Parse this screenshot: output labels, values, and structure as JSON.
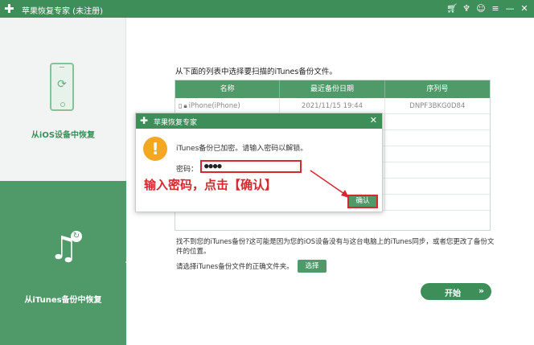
{
  "window": {
    "title": "苹果恢复专家 (未注册)",
    "controls": [
      "cart-icon",
      "settings-icon",
      "chat-icon",
      "menu-icon",
      "minimize-icon",
      "close-icon"
    ]
  },
  "sidebar": {
    "items": [
      {
        "label": "从iOS设备中恢复",
        "icon": "phone-sync-icon",
        "active": false
      },
      {
        "label": "从iTunes备份中恢复",
        "icon": "music-note-icon",
        "active": true
      }
    ]
  },
  "main": {
    "instruction": "从下面的列表中选择要扫描的iTunes备份文件。",
    "table": {
      "columns": [
        "名称",
        "最近备份日期",
        "序列号"
      ],
      "rows": [
        {
          "name": "iPhone(iPhone)",
          "date": "2021/11/15 19:44",
          "serial": "DNPF3BKG0D84"
        }
      ],
      "empty_rows": 6
    },
    "note": "找不到您的iTunes备份?这可能是因为您的iOS设备没有与这台电脑上的iTunes同步，或者您更改了备份文件的位置。",
    "choose_prompt": "请选择iTunes备份文件的正确文件夹。",
    "choose_button": "选择",
    "start_button": "开始"
  },
  "dialog": {
    "title": "苹果恢复专家",
    "message": "iTunes备份已加密。请输入密码以解锁。",
    "password_label": "密码：",
    "password_value": "●●●●",
    "ok_button": "确认"
  },
  "annotation": {
    "text": "输入密码，点击【确认】",
    "color": "#d9272e"
  },
  "colors": {
    "brand": "#3e8e5a",
    "accent": "#4f9a68",
    "warning": "#f5a623"
  }
}
